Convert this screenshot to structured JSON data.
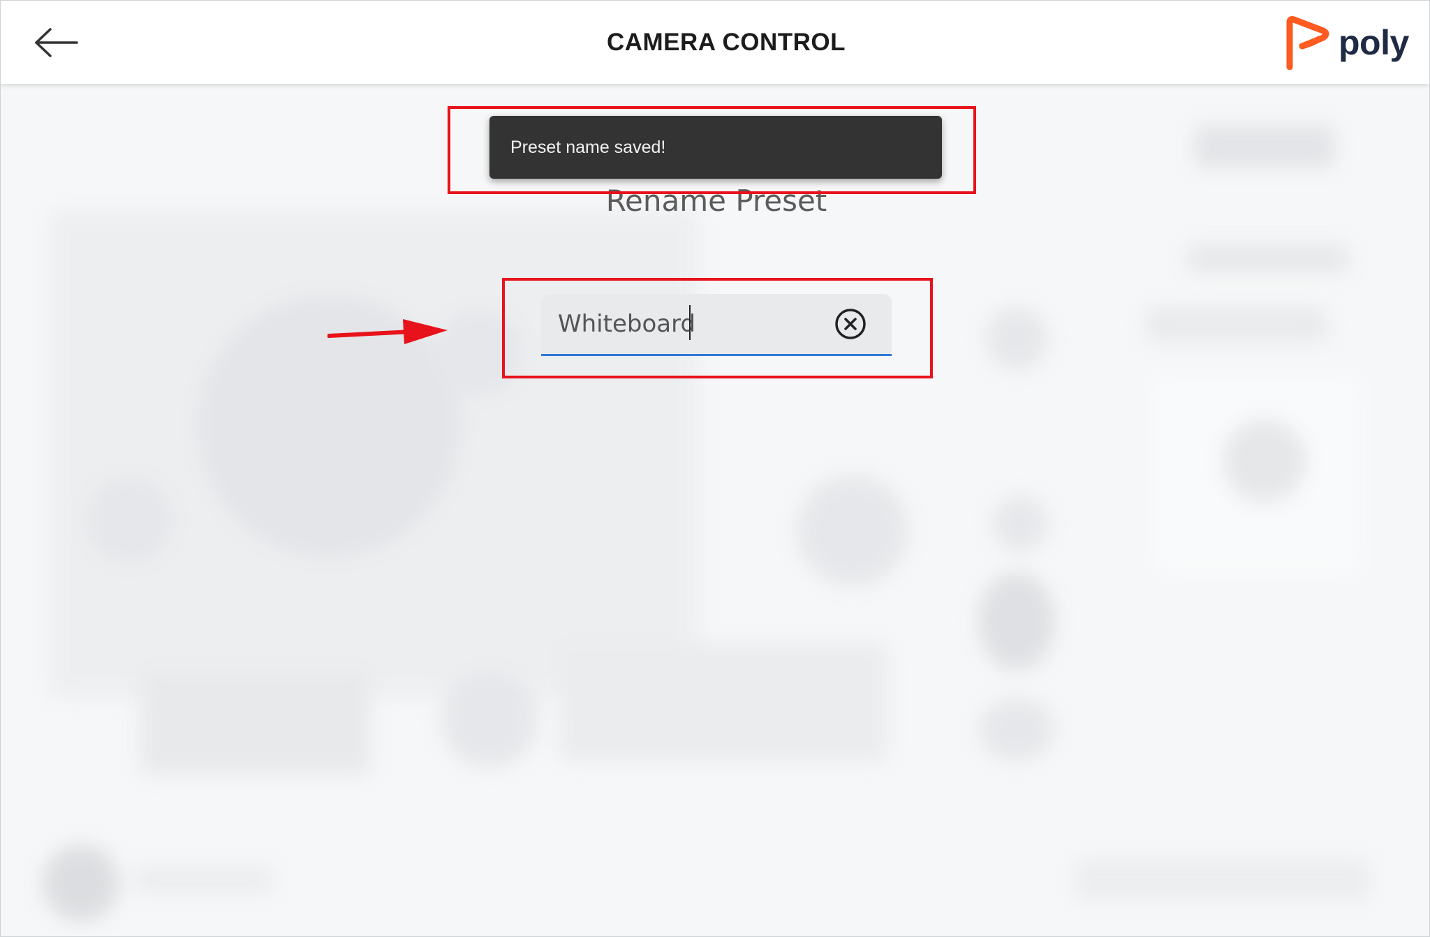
{
  "header": {
    "title": "CAMERA CONTROL",
    "back_icon": "arrow-left-icon",
    "logo_text": "poly",
    "logo_color": "#ff5a1f"
  },
  "toast": {
    "message": "Preset name saved!"
  },
  "rename_dialog": {
    "title": "Rename Preset",
    "input_value": "Whiteboard",
    "clear_icon": "clear-circle-x-icon"
  },
  "colors": {
    "accent_blue": "#2f7ad8",
    "annotation_red": "#e8121b",
    "toast_bg": "#333333"
  }
}
